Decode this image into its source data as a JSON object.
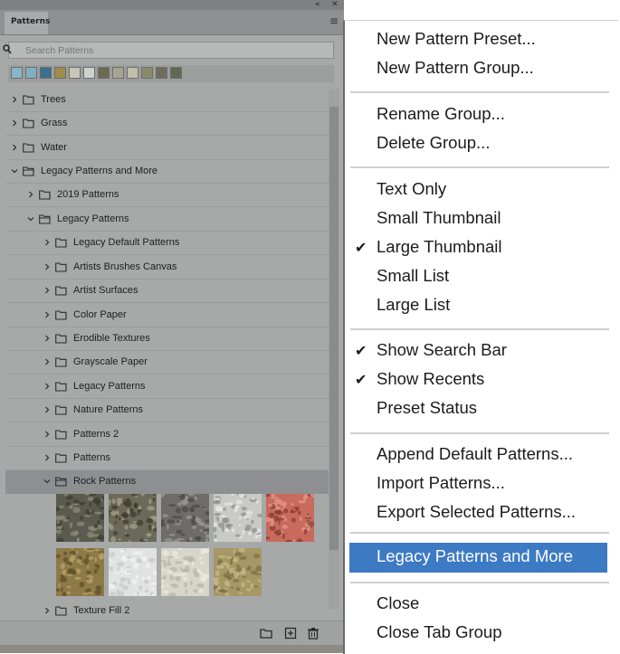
{
  "panel": {
    "tab_label": "Patterns",
    "collapse_glyph": "«",
    "close_glyph": "✕",
    "menu_glyph": "≡",
    "search_placeholder": "Search Patterns",
    "recent_colors": [
      "#8ab4c8",
      "#7fb0c0",
      "#3c6f8c",
      "#a08d4a",
      "#c9c6b8",
      "#d0d0cc",
      "#6c6a52",
      "#a8a493",
      "#c2bfa8",
      "#8a8a6a",
      "#6f6d5e",
      "#5f6a55"
    ],
    "tree": [
      {
        "label": "Trees",
        "level": 0,
        "expanded": false
      },
      {
        "label": "Grass",
        "level": 0,
        "expanded": false
      },
      {
        "label": "Water",
        "level": 0,
        "expanded": false
      },
      {
        "label": "Legacy Patterns and More",
        "level": 0,
        "expanded": true
      },
      {
        "label": "2019 Patterns",
        "level": 1,
        "expanded": false
      },
      {
        "label": "Legacy Patterns",
        "level": 1,
        "expanded": true
      },
      {
        "label": "Legacy Default Patterns",
        "level": 2,
        "expanded": false
      },
      {
        "label": "Artists Brushes Canvas",
        "level": 2,
        "expanded": false
      },
      {
        "label": "Artist Surfaces",
        "level": 2,
        "expanded": false
      },
      {
        "label": "Color Paper",
        "level": 2,
        "expanded": false
      },
      {
        "label": "Erodible Textures",
        "level": 2,
        "expanded": false
      },
      {
        "label": "Grayscale Paper",
        "level": 2,
        "expanded": false
      },
      {
        "label": "Legacy Patterns",
        "level": 2,
        "expanded": false
      },
      {
        "label": "Nature Patterns",
        "level": 2,
        "expanded": false
      },
      {
        "label": "Patterns 2",
        "level": 2,
        "expanded": false
      },
      {
        "label": "Patterns",
        "level": 2,
        "expanded": false
      },
      {
        "label": "Rock Patterns",
        "level": 2,
        "expanded": true
      },
      {
        "label": "Texture Fill 2",
        "level": 2,
        "expanded": false
      }
    ],
    "thumbnails": [
      {
        "name": "rock-1",
        "colors": [
          "#5a5a4e",
          "#8d8b78",
          "#3e3d34"
        ]
      },
      {
        "name": "rock-2",
        "colors": [
          "#6b6a58",
          "#a3a08b",
          "#3d3b30"
        ]
      },
      {
        "name": "rock-3",
        "colors": [
          "#6d6c68",
          "#9c9b95",
          "#4a4946"
        ]
      },
      {
        "name": "rock-4",
        "colors": [
          "#c9c9c6",
          "#e8e8e5",
          "#8f8f8b"
        ]
      },
      {
        "name": "rock-5",
        "colors": [
          "#c86a5c",
          "#e39a8c",
          "#8a3c33"
        ]
      },
      {
        "name": "rock-6",
        "colors": [
          "#8e7a46",
          "#b8a36a",
          "#5d4f2c"
        ]
      },
      {
        "name": "rock-7",
        "colors": [
          "#e1e3e3",
          "#f3f3f2",
          "#c7c9c9"
        ]
      },
      {
        "name": "rock-8",
        "colors": [
          "#d7d6c7",
          "#ebeae0",
          "#b8b6a4"
        ]
      },
      {
        "name": "rock-9",
        "colors": [
          "#a59865",
          "#c6b986",
          "#7b6f46"
        ]
      }
    ]
  },
  "menu": {
    "items": [
      "New Pattern Preset...",
      "New Pattern Group...",
      "Rename Group...",
      "Delete Group...",
      "Text Only",
      "Small Thumbnail",
      "Large Thumbnail",
      "Small List",
      "Large List",
      "Show Search Bar",
      "Show Recents",
      "Preset Status",
      "Append Default Patterns...",
      "Import Patterns...",
      "Export Selected Patterns...",
      "Legacy Patterns and More",
      "Close",
      "Close Tab Group"
    ],
    "checked": [
      "Large Thumbnail",
      "Show Search Bar",
      "Show Recents"
    ],
    "highlighted": "Legacy Patterns and More",
    "highlight_color": "#3d7ac4"
  }
}
